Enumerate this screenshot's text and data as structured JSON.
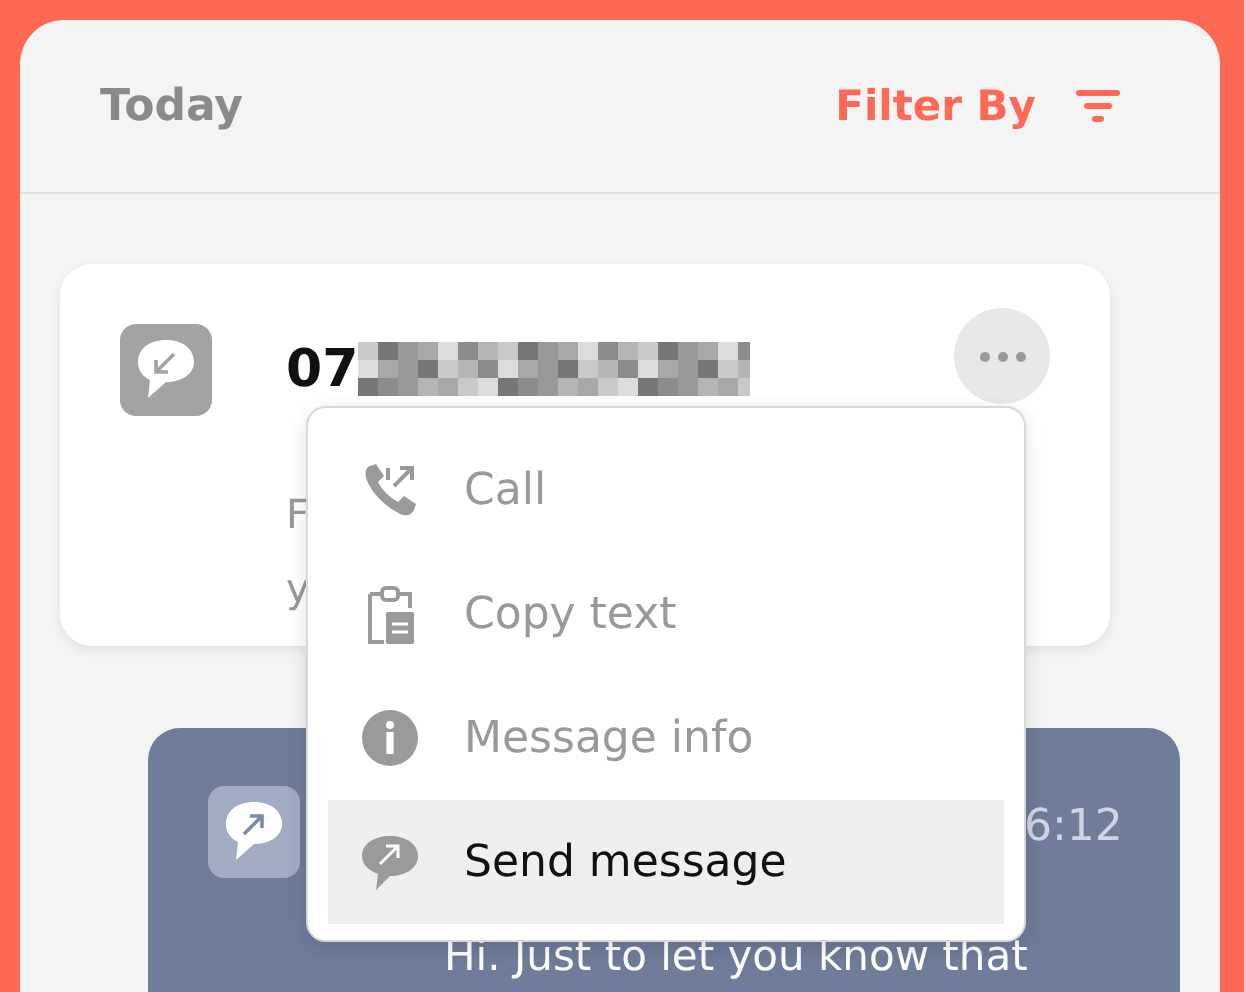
{
  "header": {
    "title": "Today",
    "filter_label": "Filter By"
  },
  "messages": [
    {
      "kind": "incoming",
      "sender": "07",
      "preview_lines": [
        "F",
        "y"
      ]
    },
    {
      "kind": "outgoing",
      "time": "6:12",
      "preview_lines": [
        "Hi. Just to let you know that"
      ]
    }
  ],
  "context_menu": {
    "items": [
      {
        "label": "Call",
        "selected": false
      },
      {
        "label": "Copy text",
        "selected": false
      },
      {
        "label": "Message info",
        "selected": false
      },
      {
        "label": "Send message",
        "selected": true
      }
    ]
  }
}
